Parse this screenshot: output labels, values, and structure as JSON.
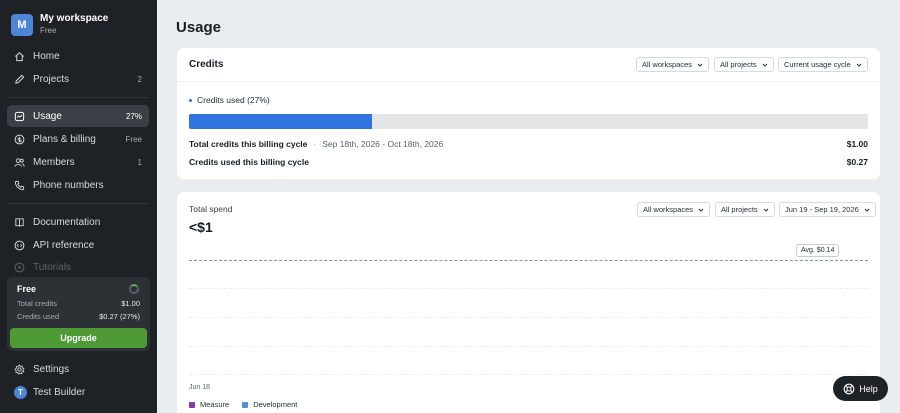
{
  "workspace": {
    "initial": "M",
    "name": "My workspace",
    "plan": "Free"
  },
  "nav": {
    "home": {
      "label": "Home",
      "icon": "home-icon"
    },
    "projects": {
      "label": "Projects",
      "badge": "2",
      "icon": "pencil-icon"
    },
    "usage": {
      "label": "Usage",
      "badge": "27%",
      "icon": "chart-icon"
    },
    "plans": {
      "label": "Plans & billing",
      "badge": "Free",
      "icon": "dollar-icon"
    },
    "members": {
      "label": "Members",
      "badge": "1",
      "icon": "users-icon"
    },
    "phone": {
      "label": "Phone numbers",
      "icon": "phone-icon"
    },
    "docs": {
      "label": "Documentation",
      "icon": "book-icon"
    },
    "api": {
      "label": "API reference",
      "icon": "code-icon"
    },
    "tutorials": {
      "label": "Tutorials",
      "icon": "play-icon"
    }
  },
  "credit_card": {
    "title": "Free",
    "total_label": "Total credits",
    "total_value": "$1.00",
    "used_label": "Credits used",
    "used_value": "$0.27 (27%)",
    "upgrade_label": "Upgrade"
  },
  "footer_nav": {
    "settings": {
      "label": "Settings",
      "icon": "gear-icon"
    },
    "user": {
      "initial": "T",
      "label": "Test Builder"
    }
  },
  "page": {
    "title": "Usage"
  },
  "credits_card": {
    "title": "Credits",
    "filters": {
      "workspaces": "All workspaces",
      "projects": "All projects",
      "cycle": "Current usage cycle"
    },
    "used_label": "Credits used (27%)",
    "used_fraction": 0.27,
    "total_label": "Total credits this billing cycle",
    "range_sep": "·",
    "range": "Sep 18th, 2026 - Oct 18th, 2026",
    "total_amount": "$1.00",
    "used_row_label": "Credits used this billing cycle",
    "used_amount": "$0.27"
  },
  "spend_card": {
    "title": "Total spend",
    "value": "<$1",
    "filters": {
      "workspaces": "All workspaces",
      "projects": "All projects",
      "range": "Jun 19 - Sep 19, 2026"
    },
    "avg_label": "Avg. $0.14",
    "x_tick": "Jun 18",
    "legend": [
      {
        "label": "Measure",
        "color": "#7d3ea8"
      },
      {
        "label": "Development",
        "color": "#4f8fd9"
      }
    ]
  },
  "help": {
    "label": "Help"
  },
  "colors": {
    "accent_blue": "#2f74e0",
    "upgrade_green": "#4e9a34",
    "sidebar_bg": "#1e2226"
  }
}
